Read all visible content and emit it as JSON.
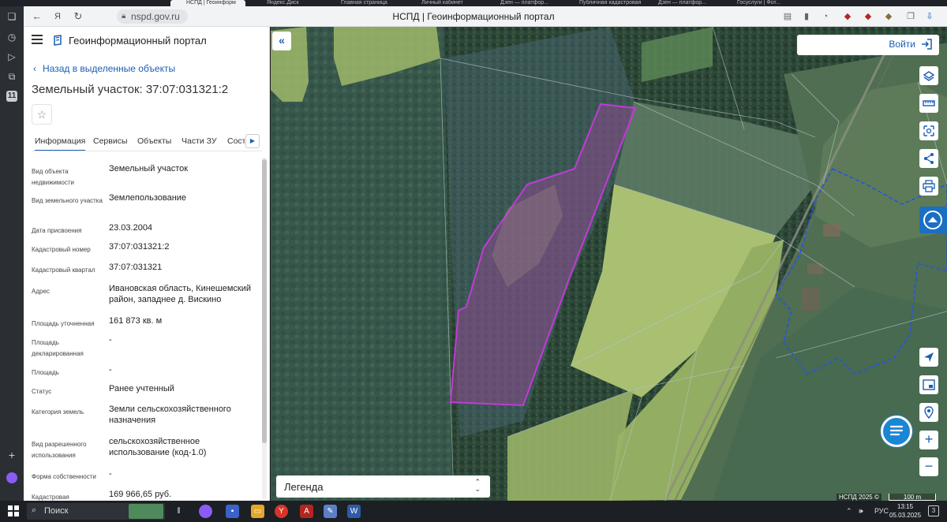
{
  "browser": {
    "tabs": [
      {
        "label": "",
        "active": false
      },
      {
        "label": "НСПД | Геоинформ",
        "active": true
      },
      {
        "label": "Яндекс.Диск",
        "active": false
      },
      {
        "label": "Главная страница",
        "active": false
      },
      {
        "label": "Личный кабинет",
        "active": false
      },
      {
        "label": "Дзен — платфор...",
        "active": false
      },
      {
        "label": "Публичная кадастровая",
        "active": false
      },
      {
        "label": "Дзен — платфор...",
        "active": false
      },
      {
        "label": "Госуслуги | Фот...",
        "active": false
      }
    ],
    "url": "nspd.gov.ru",
    "page_title": "НСПД | Геоинформационный портал",
    "sidebar_badge": "11"
  },
  "panel": {
    "portal_name": "Геоинформационный портал",
    "back_label": "Назад в выделенные объекты",
    "object_title": "Земельный участок: 37:07:031321:2",
    "tabs": [
      "Информация",
      "Сервисы",
      "Объекты",
      "Части ЗУ",
      "Состав"
    ],
    "rows": [
      {
        "key": "Вид объекта недвижимости",
        "value": "Земельный участок"
      },
      {
        "key": "Вид земельного участка",
        "value": "Землепользование"
      },
      {
        "key": "Дата присвоения",
        "value": "23.03.2004"
      },
      {
        "key": "Кадастровый номер",
        "value": "37:07:031321:2"
      },
      {
        "key": "Кадастровый квартал",
        "value": "37:07:031321"
      },
      {
        "key": "Адрес",
        "value": "Ивановская область, Кинешемский район, западнее д. Вискино"
      },
      {
        "key": "Площадь уточненная",
        "value": "161 873 кв. м"
      },
      {
        "key": "Площадь декларированная",
        "value": "-"
      },
      {
        "key": "Площадь",
        "value": "-"
      },
      {
        "key": "Статус",
        "value": "Ранее учтенный"
      },
      {
        "key": "Категория земель",
        "value": "Земли сельскохозяйственного назначения"
      },
      {
        "key": "Вид разрешенного использования",
        "value": "сельскохозяйственное использование (код-1.0)"
      },
      {
        "key": "Форма собственности",
        "value": "-"
      },
      {
        "key": "Кадастровая",
        "value": "169 966,65 руб."
      }
    ]
  },
  "map": {
    "login_label": "Войти",
    "legend_label": "Легенда",
    "copyright": "НСПД 2025 ©",
    "scale_label": "100 m",
    "colors": {
      "parcel_outline": "#c23ad6",
      "parcel_fill": "#8a4a8c",
      "field_light": "#9bb56a",
      "forest_dark": "#2f4a3c",
      "boundary_blue": "#2255e6",
      "button_blue": "#1a5fb4"
    }
  },
  "taskbar": {
    "search_label": "Поиск",
    "lang": "РУС",
    "time": "13:15",
    "date": "05.03.2025",
    "notification_count": "3"
  }
}
